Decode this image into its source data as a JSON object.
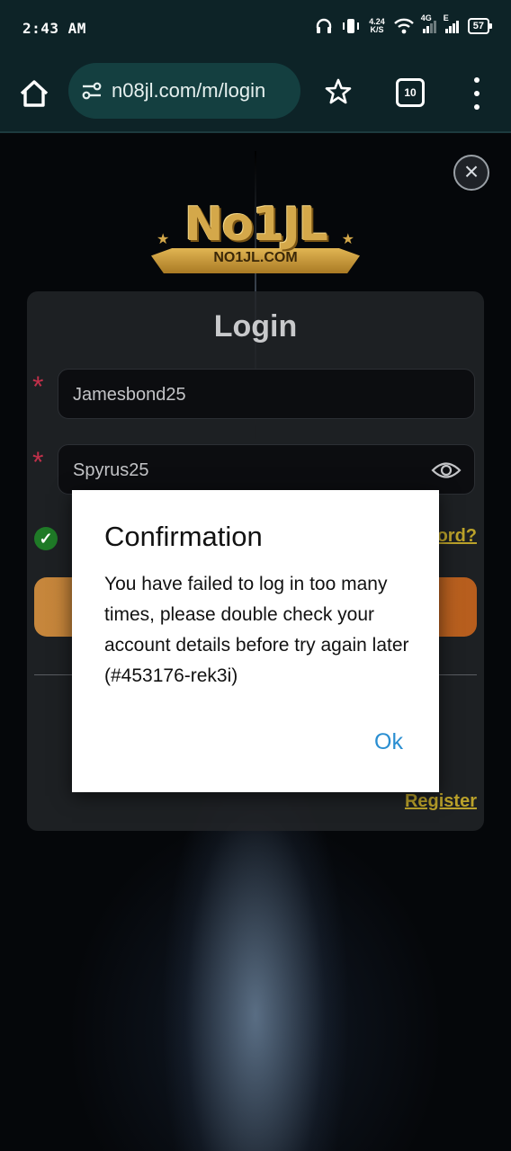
{
  "status_bar": {
    "time": "2:43 AM",
    "speed_value": "4.24",
    "speed_unit": "K/S",
    "net1_label": "4G",
    "net2_label": "E",
    "battery": "57"
  },
  "browser": {
    "url": "n08jl.com/m/login",
    "tab_count": "10"
  },
  "page": {
    "logo_main": "No1JL",
    "logo_sub": "NO1JL.COM",
    "login_title": "Login",
    "username_value": "Jamesbond25",
    "password_value": "Spyrus25",
    "required_mark": "*",
    "remember_checkmark": "✓",
    "forgot_visible": "ord?",
    "register_label": "Register",
    "close_glyph": "×"
  },
  "dialog": {
    "title": "Confirmation",
    "message": "You have failed to log in too many times, please double check your account details before try again later (#453176-rek3i)",
    "ok_label": "Ok"
  },
  "colors": {
    "status_bar_bg": "#0d2327",
    "url_box_bg": "#143f40",
    "accent_gold": "#bba22a",
    "required_red": "#c0304a",
    "login_button": "#c6873c",
    "ok_blue": "#2a8ed1"
  }
}
